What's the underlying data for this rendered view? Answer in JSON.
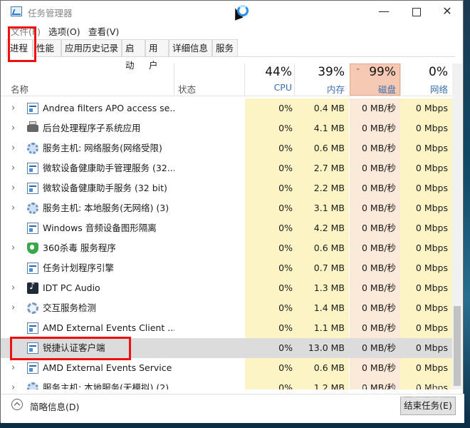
{
  "window": {
    "title": "任务管理器"
  },
  "menu": {
    "file": "文件(F)",
    "options": "选项(O)",
    "view": "查看(V)"
  },
  "tabs": [
    "进程",
    "性能",
    "应用历史记录",
    "启动",
    "用户",
    "详细信息",
    "服务"
  ],
  "columns": {
    "name": "名称",
    "status": "状态",
    "cpu": {
      "pct": "44%",
      "label": "CPU"
    },
    "memory": {
      "pct": "39%",
      "label": "内存"
    },
    "disk": {
      "pct": "99%",
      "label": "磁盘"
    },
    "network": {
      "pct": "0%",
      "label": "网络"
    }
  },
  "rows": [
    {
      "name": "Andrea filters APO access se...",
      "icon": "service-window-icon",
      "expand": true,
      "cpu": "0%",
      "mem": "0.4 MB",
      "disk": "0 MB/秒",
      "net": "0 Mbps"
    },
    {
      "name": "后台处理程序子系统应用",
      "icon": "printer-icon",
      "expand": true,
      "cpu": "0%",
      "mem": "4.1 MB",
      "disk": "0 MB/秒",
      "net": "0 Mbps"
    },
    {
      "name": "服务主机: 网络服务(网络受限)",
      "icon": "gear-icon",
      "expand": true,
      "cpu": "0%",
      "mem": "0.6 MB",
      "disk": "0 MB/秒",
      "net": "0 Mbps"
    },
    {
      "name": "微软设备健康助手管理服务 (32...",
      "icon": "service-window-icon",
      "expand": true,
      "cpu": "0%",
      "mem": "2.7 MB",
      "disk": "0 MB/秒",
      "net": "0 Mbps"
    },
    {
      "name": "微软设备健康助手服务 (32 bit)",
      "icon": "service-window-icon",
      "expand": true,
      "cpu": "0%",
      "mem": "2.2 MB",
      "disk": "0 MB/秒",
      "net": "0 Mbps"
    },
    {
      "name": "服务主机: 本地服务(无网络) (3)",
      "icon": "gear-icon",
      "expand": true,
      "cpu": "0%",
      "mem": "3.1 MB",
      "disk": "0 MB/秒",
      "net": "0 Mbps"
    },
    {
      "name": "Windows 音频设备图形隔离",
      "icon": "service-window-icon",
      "expand": false,
      "cpu": "0%",
      "mem": "4.2 MB",
      "disk": "0 MB/秒",
      "net": "0 Mbps"
    },
    {
      "name": "360杀毒 服务程序",
      "icon": "shield-icon",
      "expand": true,
      "cpu": "0%",
      "mem": "0.6 MB",
      "disk": "0 MB/秒",
      "net": "0 Mbps"
    },
    {
      "name": "任务计划程序引擎",
      "icon": "service-window-icon",
      "expand": false,
      "cpu": "0%",
      "mem": "0.7 MB",
      "disk": "0 MB/秒",
      "net": "0 Mbps"
    },
    {
      "name": "IDT PC Audio",
      "icon": "audio-icon",
      "expand": true,
      "cpu": "0%",
      "mem": "1.3 MB",
      "disk": "0 MB/秒",
      "net": "0 Mbps"
    },
    {
      "name": "交互服务检测",
      "icon": "cog-icon",
      "expand": true,
      "cpu": "0%",
      "mem": "1.4 MB",
      "disk": "0 MB/秒",
      "net": "0 Mbps"
    },
    {
      "name": "AMD External Events Client ...",
      "icon": "service-window-icon",
      "expand": false,
      "cpu": "0%",
      "mem": "1.1 MB",
      "disk": "0 MB/秒",
      "net": "0 Mbps"
    },
    {
      "name": "锐捷认证客户端",
      "icon": "service-window-icon",
      "expand": false,
      "selected": true,
      "cpu": "0%",
      "mem": "13.0 MB",
      "disk": "0 MB/秒",
      "net": "0 Mbps"
    },
    {
      "name": "AMD External Events Service ...",
      "icon": "service-window-icon",
      "expand": true,
      "cpu": "0%",
      "mem": "0.6 MB",
      "disk": "0 MB/秒",
      "net": "0 Mbps"
    },
    {
      "name": "服务主机: 本地服务(无模拟) (2)",
      "icon": "gear-icon",
      "expand": true,
      "cpu": "0%",
      "mem": "1.2 MB",
      "disk": "0 MB/秒",
      "net": "0 Mbps"
    }
  ],
  "footer": {
    "fewer_details": "简略信息(D)",
    "end_task": "结束任务(E)"
  },
  "watermark": "Baidu 经验",
  "colors": {
    "cpu_bg": "#fdf4c5",
    "mem_bg": "#fdf4c5",
    "disk_bg": "#fbe9d9",
    "net_bg": "#fdf4c5",
    "highlight": "#ee1111"
  }
}
